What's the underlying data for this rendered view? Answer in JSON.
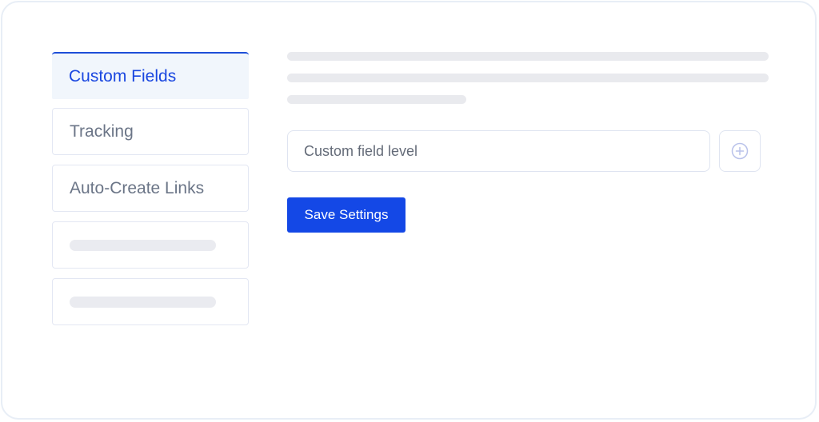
{
  "sidebar": {
    "items": [
      {
        "label": "Custom Fields",
        "active": true
      },
      {
        "label": "Tracking",
        "active": false
      },
      {
        "label": "Auto-Create Links",
        "active": false
      }
    ]
  },
  "main": {
    "custom_field": {
      "placeholder": "Custom field level",
      "value": ""
    },
    "add_button_icon": "plus-circle-icon",
    "save_label": "Save Settings"
  },
  "colors": {
    "accent": "#1448e6",
    "active_text": "#1a47e0",
    "active_bg": "#f1f6fc",
    "skeleton": "#e9eaee",
    "border": "#e3e7f3"
  }
}
